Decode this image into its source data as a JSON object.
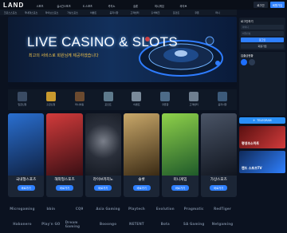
{
  "header": {
    "logo": "LAND",
    "slogan": "사이트 안전 가입",
    "slogan_badge": "LAND",
    "nav": [
      "스포츠",
      "실시간스포츠",
      "E-스포츠",
      "카지노",
      "슬롯",
      "미니게임",
      "라이브"
    ],
    "login_label": "로그인",
    "join_label": "회원가입"
  },
  "subnav": [
    "크로스스포츠",
    "국내형스포츠",
    "라이브스포츠",
    "가상스포츠",
    "이벤트",
    "공지사항",
    "고객센터",
    "출석체크",
    "포인트",
    "쿠폰",
    "머니"
  ],
  "banner": {
    "title": "LIVE CASINO & SLOTS",
    "subtitle": "최고의 서비스로 회원님께 제공하겠습니다"
  },
  "icon_row": [
    {
      "label": "입금신청",
      "color": "#3a4b63"
    },
    {
      "label": "출금신청",
      "color": "#c99a2e"
    },
    {
      "label": "머니이동",
      "color": "#6b4a2f"
    },
    {
      "label": "포인트",
      "color": "#5e7a8c"
    },
    {
      "label": "이벤트",
      "color": "#7a8a9a"
    },
    {
      "label": "쿠폰함",
      "color": "#4d6b88"
    },
    {
      "label": "고객센터",
      "color": "#6f7f90"
    },
    {
      "label": "공지사항",
      "color": "#3c5a7a"
    }
  ],
  "cards": [
    {
      "title": "국내형스포츠",
      "button": "바로가기",
      "color": "#2a6fd0"
    },
    {
      "title": "해외형스포츠",
      "button": "바로가기",
      "color": "#d23b3b"
    },
    {
      "title": "라이브카지노",
      "button": "바로가기",
      "color": "#3a3f4a"
    },
    {
      "title": "슬롯",
      "button": "바로가기",
      "color": "#8a6a3a"
    },
    {
      "title": "미니게임",
      "button": "바로가기",
      "color": "#e0b51c"
    },
    {
      "title": "가상스포츠",
      "button": "바로가기",
      "color": "#2a3344"
    }
  ],
  "providers": [
    "Microgaming",
    "bbin",
    "CQ9",
    "Asia Gaming",
    "Playtech",
    "Evolution",
    "Pragmatic",
    "RedTiger",
    "Habanero",
    "Play'n GO",
    "Dream Gaming",
    "Booongo",
    "NETENT",
    "Bota",
    "SA Gaming",
    "Netgaming"
  ],
  "right_panel": {
    "login_title": "로그인하기",
    "id_placeholder": "아이디",
    "pw_placeholder": "비밀번호",
    "login_button": "로그인",
    "join_button": "회원가입",
    "stats_title": "입출금현황",
    "telegram": "TELEGRAM",
    "ad1": "평생조소하트",
    "ad2": "랜드 스포츠TV"
  }
}
